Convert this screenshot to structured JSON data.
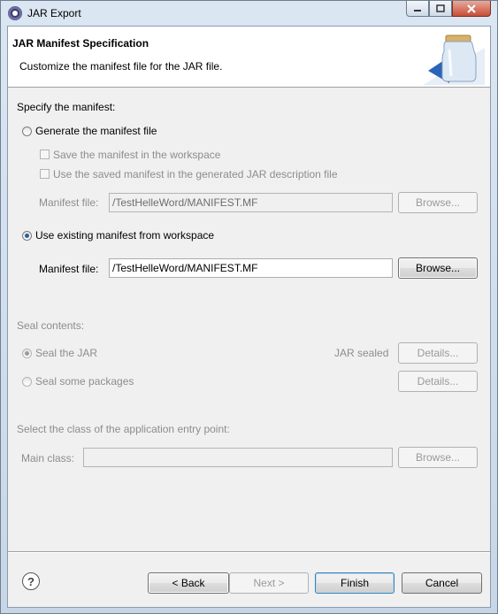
{
  "window": {
    "title": "JAR Export"
  },
  "header": {
    "title": "JAR Manifest Specification",
    "description": "Customize the manifest file for the JAR file."
  },
  "manifest": {
    "section_label": "Specify the manifest:",
    "generate_label": "Generate the manifest file",
    "save_in_workspace_label": "Save the manifest in the workspace",
    "use_saved_label": "Use the saved manifest in the generated JAR description file",
    "gen_file_label": "Manifest file:",
    "gen_file_value": "/TestHelleWord/MANIFEST.MF",
    "gen_browse_label": "Browse...",
    "existing_label": "Use existing manifest from workspace",
    "existing_file_label": "Manifest file:",
    "existing_file_value": "/TestHelleWord/MANIFEST.MF",
    "existing_browse_label": "Browse...",
    "selected_option": "existing"
  },
  "seal": {
    "section_label": "Seal contents:",
    "seal_jar_label": "Seal the JAR",
    "jar_sealed_status": "JAR sealed",
    "details_label": "Details...",
    "seal_packages_label": "Seal some packages",
    "details2_label": "Details..."
  },
  "entry": {
    "section_label": "Select the class of the application entry point:",
    "main_class_label": "Main class:",
    "main_class_value": "",
    "browse_label": "Browse..."
  },
  "footer": {
    "back_label": "< Back",
    "next_label": "Next >",
    "finish_label": "Finish",
    "cancel_label": "Cancel",
    "help_icon": "?"
  }
}
